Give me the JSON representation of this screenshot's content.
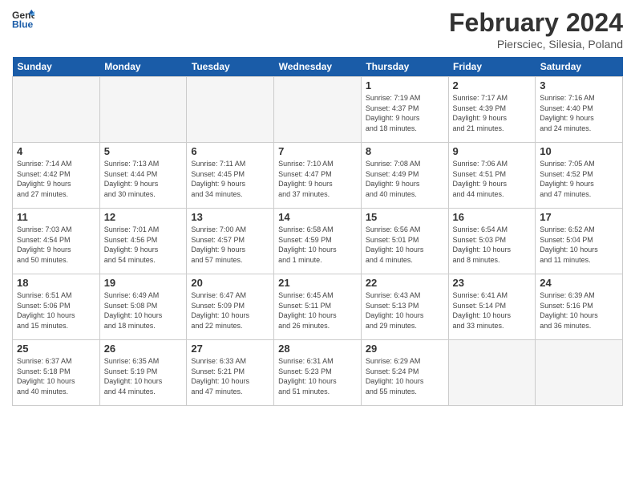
{
  "header": {
    "logo_line1": "General",
    "logo_line2": "Blue",
    "month_title": "February 2024",
    "subtitle": "Piersciec, Silesia, Poland"
  },
  "days_of_week": [
    "Sunday",
    "Monday",
    "Tuesday",
    "Wednesday",
    "Thursday",
    "Friday",
    "Saturday"
  ],
  "weeks": [
    [
      {
        "day": "",
        "info": ""
      },
      {
        "day": "",
        "info": ""
      },
      {
        "day": "",
        "info": ""
      },
      {
        "day": "",
        "info": ""
      },
      {
        "day": "1",
        "info": "Sunrise: 7:19 AM\nSunset: 4:37 PM\nDaylight: 9 hours\nand 18 minutes."
      },
      {
        "day": "2",
        "info": "Sunrise: 7:17 AM\nSunset: 4:39 PM\nDaylight: 9 hours\nand 21 minutes."
      },
      {
        "day": "3",
        "info": "Sunrise: 7:16 AM\nSunset: 4:40 PM\nDaylight: 9 hours\nand 24 minutes."
      }
    ],
    [
      {
        "day": "4",
        "info": "Sunrise: 7:14 AM\nSunset: 4:42 PM\nDaylight: 9 hours\nand 27 minutes."
      },
      {
        "day": "5",
        "info": "Sunrise: 7:13 AM\nSunset: 4:44 PM\nDaylight: 9 hours\nand 30 minutes."
      },
      {
        "day": "6",
        "info": "Sunrise: 7:11 AM\nSunset: 4:45 PM\nDaylight: 9 hours\nand 34 minutes."
      },
      {
        "day": "7",
        "info": "Sunrise: 7:10 AM\nSunset: 4:47 PM\nDaylight: 9 hours\nand 37 minutes."
      },
      {
        "day": "8",
        "info": "Sunrise: 7:08 AM\nSunset: 4:49 PM\nDaylight: 9 hours\nand 40 minutes."
      },
      {
        "day": "9",
        "info": "Sunrise: 7:06 AM\nSunset: 4:51 PM\nDaylight: 9 hours\nand 44 minutes."
      },
      {
        "day": "10",
        "info": "Sunrise: 7:05 AM\nSunset: 4:52 PM\nDaylight: 9 hours\nand 47 minutes."
      }
    ],
    [
      {
        "day": "11",
        "info": "Sunrise: 7:03 AM\nSunset: 4:54 PM\nDaylight: 9 hours\nand 50 minutes."
      },
      {
        "day": "12",
        "info": "Sunrise: 7:01 AM\nSunset: 4:56 PM\nDaylight: 9 hours\nand 54 minutes."
      },
      {
        "day": "13",
        "info": "Sunrise: 7:00 AM\nSunset: 4:57 PM\nDaylight: 9 hours\nand 57 minutes."
      },
      {
        "day": "14",
        "info": "Sunrise: 6:58 AM\nSunset: 4:59 PM\nDaylight: 10 hours\nand 1 minute."
      },
      {
        "day": "15",
        "info": "Sunrise: 6:56 AM\nSunset: 5:01 PM\nDaylight: 10 hours\nand 4 minutes."
      },
      {
        "day": "16",
        "info": "Sunrise: 6:54 AM\nSunset: 5:03 PM\nDaylight: 10 hours\nand 8 minutes."
      },
      {
        "day": "17",
        "info": "Sunrise: 6:52 AM\nSunset: 5:04 PM\nDaylight: 10 hours\nand 11 minutes."
      }
    ],
    [
      {
        "day": "18",
        "info": "Sunrise: 6:51 AM\nSunset: 5:06 PM\nDaylight: 10 hours\nand 15 minutes."
      },
      {
        "day": "19",
        "info": "Sunrise: 6:49 AM\nSunset: 5:08 PM\nDaylight: 10 hours\nand 18 minutes."
      },
      {
        "day": "20",
        "info": "Sunrise: 6:47 AM\nSunset: 5:09 PM\nDaylight: 10 hours\nand 22 minutes."
      },
      {
        "day": "21",
        "info": "Sunrise: 6:45 AM\nSunset: 5:11 PM\nDaylight: 10 hours\nand 26 minutes."
      },
      {
        "day": "22",
        "info": "Sunrise: 6:43 AM\nSunset: 5:13 PM\nDaylight: 10 hours\nand 29 minutes."
      },
      {
        "day": "23",
        "info": "Sunrise: 6:41 AM\nSunset: 5:14 PM\nDaylight: 10 hours\nand 33 minutes."
      },
      {
        "day": "24",
        "info": "Sunrise: 6:39 AM\nSunset: 5:16 PM\nDaylight: 10 hours\nand 36 minutes."
      }
    ],
    [
      {
        "day": "25",
        "info": "Sunrise: 6:37 AM\nSunset: 5:18 PM\nDaylight: 10 hours\nand 40 minutes."
      },
      {
        "day": "26",
        "info": "Sunrise: 6:35 AM\nSunset: 5:19 PM\nDaylight: 10 hours\nand 44 minutes."
      },
      {
        "day": "27",
        "info": "Sunrise: 6:33 AM\nSunset: 5:21 PM\nDaylight: 10 hours\nand 47 minutes."
      },
      {
        "day": "28",
        "info": "Sunrise: 6:31 AM\nSunset: 5:23 PM\nDaylight: 10 hours\nand 51 minutes."
      },
      {
        "day": "29",
        "info": "Sunrise: 6:29 AM\nSunset: 5:24 PM\nDaylight: 10 hours\nand 55 minutes."
      },
      {
        "day": "",
        "info": ""
      },
      {
        "day": "",
        "info": ""
      }
    ]
  ]
}
